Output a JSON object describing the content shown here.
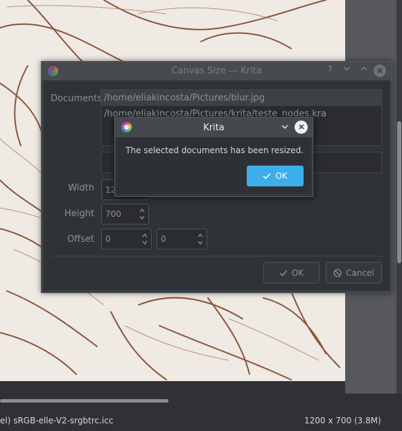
{
  "canvas_dialog": {
    "title": "Canvas Size — Krita",
    "help_label": "?",
    "documents_label": "Documents",
    "documents": [
      {
        "path": "/home/eliakincosta/Pictures/blur.jpg"
      },
      {
        "path": "/home/eliakincosta/Pictures/krita/teste_nodes.kra"
      }
    ],
    "width_label": "Width",
    "width_value": "12",
    "height_label": "Height",
    "height_value": "700",
    "offset_label": "Offset",
    "offset_x": "0",
    "offset_y": "0",
    "ok_label": "OK",
    "cancel_label": "Cancel"
  },
  "message_box": {
    "title": "Krita",
    "message": "The selected documents has been resized.",
    "ok_label": "OK"
  },
  "statusbar": {
    "profile": "el)  sRGB-elle-V2-srgbtrc.icc",
    "image_size": "1200 x 700 (3.8M)"
  },
  "icons": {
    "app": "krita-icon",
    "check": "check-icon",
    "cancel": "cancel-icon"
  },
  "colors": {
    "accent": "#3daee9",
    "sketch": "#7a3b22",
    "paper": "#efeae3"
  }
}
